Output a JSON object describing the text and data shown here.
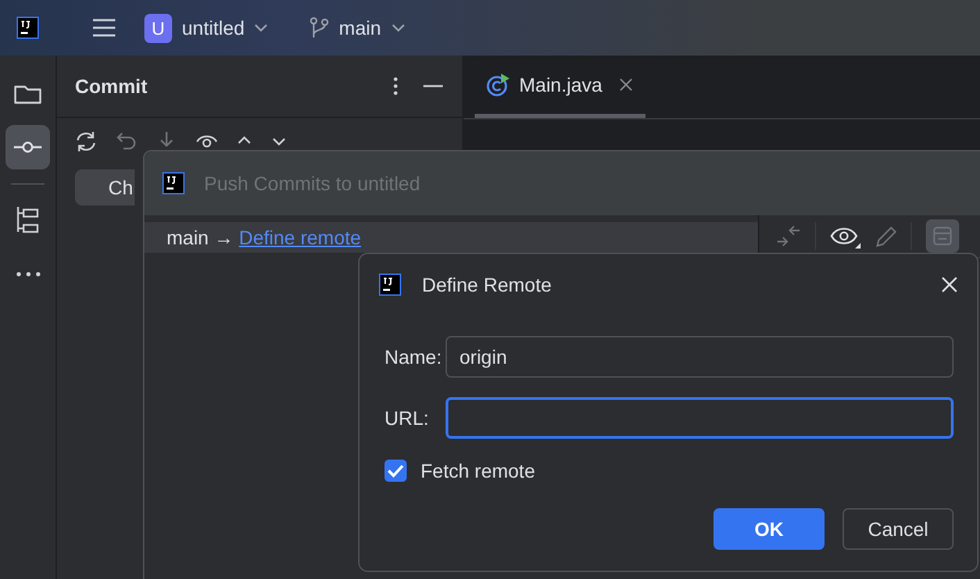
{
  "top_bar": {
    "project": {
      "badge": "U",
      "name": "untitled"
    },
    "branch": "main"
  },
  "tool_strip": [
    {
      "kind": "folder",
      "selected": false
    },
    {
      "kind": "commit",
      "selected": true
    },
    {
      "kind": "structure",
      "selected": false
    },
    {
      "kind": "more",
      "selected": false
    }
  ],
  "commit_panel": {
    "title": "Commit",
    "button": "Ch"
  },
  "editor": {
    "tabs": [
      {
        "label": "Main.java",
        "selected": true
      }
    ]
  },
  "push_dialog": {
    "title": "Push Commits to untitled",
    "branch": "main",
    "arrow": "→",
    "link": "Define remote"
  },
  "define_remote": {
    "title": "Define Remote",
    "fields": [
      {
        "label": "Name:",
        "value": "origin",
        "focused": false
      },
      {
        "label": "URL:",
        "focused": true
      }
    ],
    "fetch_remote": {
      "label": "Fetch remote",
      "checked": true
    },
    "buttons": [
      {
        "label": "OK",
        "kind": "primary"
      },
      {
        "label": "Cancel",
        "kind": "secondary"
      }
    ]
  }
}
